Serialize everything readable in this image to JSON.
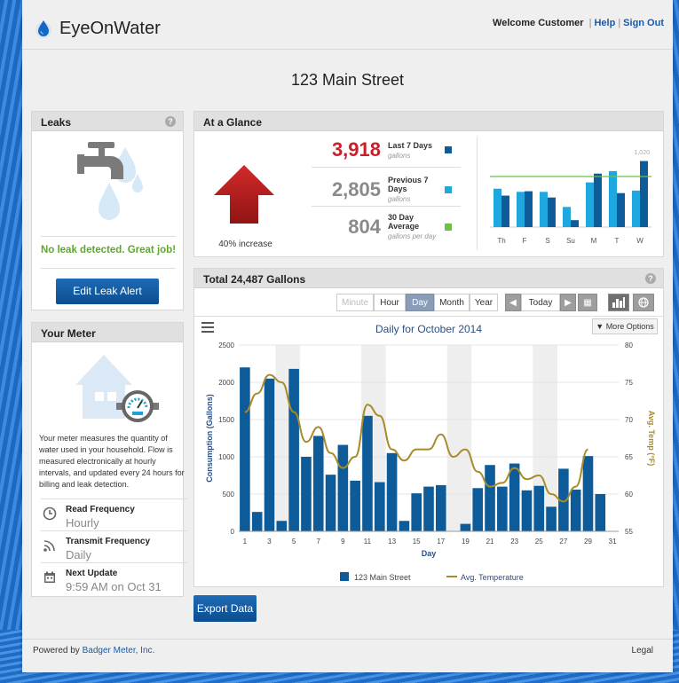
{
  "header": {
    "brand": "EyeOnWater",
    "welcome": "Welcome Customer",
    "help": "Help",
    "signout": "Sign Out",
    "separator": "|"
  },
  "address": "123 Main Street",
  "leaks": {
    "title": "Leaks",
    "help_icon": "question-icon",
    "status": "No leak detected. Great job!",
    "status_color": "#5fa82d",
    "button": "Edit Leak Alert"
  },
  "meter": {
    "title": "Your Meter",
    "description": "Your meter measures the quantity of water used in your household. Flow is measured electronically at hourly intervals, and updated every 24 hours for billing and leak detection.",
    "rows": [
      {
        "label": "Read Frequency",
        "value": "Hourly",
        "icon": "clock-icon"
      },
      {
        "label": "Transmit Frequency",
        "value": "Daily",
        "icon": "signal-icon"
      },
      {
        "label": "Next Update",
        "value": "9:59 AM on Oct 31",
        "icon": "calendar-icon"
      }
    ]
  },
  "glance": {
    "title": "At a Glance",
    "trend_label": "40% increase",
    "trend_direction": "up",
    "stats": [
      {
        "value": "3,918",
        "label": "Last 7 Days",
        "sub": "gallons",
        "color": "#c8202a",
        "swatch": "#0d5c99"
      },
      {
        "value": "2,805",
        "label": "Previous 7 Days",
        "sub": "gallons",
        "color": "#8a8a8a",
        "swatch": "#1fa8e0"
      },
      {
        "value": "804",
        "label": "30 Day Average",
        "sub": "gallons per day",
        "color": "#8a8a8a",
        "swatch": "#6cc04a"
      }
    ],
    "mini_chart": {
      "days": [
        "Th",
        "F",
        "S",
        "Su",
        "M",
        "T",
        "W"
      ],
      "last7": [
        500,
        570,
        470,
        110,
        850,
        540,
        1050
      ],
      "previous7": [
        610,
        560,
        560,
        320,
        710,
        890,
        580
      ],
      "average": 804,
      "max_label": "1,020",
      "ymax": 1100
    }
  },
  "total": {
    "title": "Total 24,487 Gallons",
    "toolbar": {
      "periods": [
        "Minute",
        "Hour",
        "Day",
        "Month",
        "Year"
      ],
      "selected": "Day",
      "disabled": "Minute",
      "today": "Today",
      "prev_icon": "arrow-left-icon",
      "next_icon": "arrow-right-icon",
      "calendar_icon": "calendar-grid-icon",
      "bar_icon": "bar-chart-icon",
      "globe_icon": "globe-icon"
    },
    "menu_icon": "hamburger-icon",
    "more_options": "▼ More Options"
  },
  "chart_data": {
    "type": "bar",
    "title": "Daily for October 2014",
    "xlabel": "Day",
    "ylabel": "Consumption (Gallons)",
    "y2label": "Avg. Temp (°F)",
    "ylim": [
      0,
      2500
    ],
    "y2lim": [
      55,
      80
    ],
    "yticks": [
      0,
      500,
      1000,
      1500,
      2000,
      2500
    ],
    "y2ticks": [
      55,
      60,
      65,
      70,
      75,
      80
    ],
    "xticks": [
      1,
      3,
      5,
      7,
      9,
      11,
      13,
      15,
      17,
      19,
      21,
      23,
      25,
      27,
      29,
      31
    ],
    "bar_color": "#0d5c99",
    "line_color": "#a88b2a",
    "series": [
      {
        "name": "123 Main Street",
        "type": "bar",
        "x": [
          1,
          2,
          3,
          4,
          5,
          6,
          7,
          8,
          9,
          10,
          11,
          12,
          13,
          14,
          15,
          16,
          17,
          18,
          19,
          20,
          21,
          22,
          23,
          24,
          25,
          26,
          27,
          28,
          29,
          30,
          31
        ],
        "values": [
          2200,
          260,
          2050,
          140,
          2180,
          1000,
          1280,
          760,
          1160,
          680,
          1550,
          660,
          1050,
          140,
          510,
          600,
          620,
          0,
          100,
          580,
          890,
          600,
          910,
          550,
          610,
          330,
          840,
          560,
          1010,
          500,
          0
        ]
      },
      {
        "name": "Avg. Temperature",
        "type": "line",
        "x": [
          1,
          2,
          3,
          4,
          5,
          6,
          7,
          8,
          9,
          10,
          11,
          12,
          13,
          14,
          15,
          16,
          17,
          18,
          19,
          20,
          21,
          22,
          23,
          24,
          25,
          26,
          27,
          28,
          29
        ],
        "values": [
          71,
          73.5,
          76,
          75,
          71,
          67,
          69,
          65.5,
          63.5,
          65,
          72,
          70.5,
          66,
          64.5,
          66,
          66,
          68,
          65,
          66,
          63,
          61,
          61.5,
          63.5,
          62,
          62.5,
          60,
          59,
          61,
          66
        ]
      }
    ],
    "shaded_days": [
      4,
      5,
      11,
      12,
      18,
      19,
      25,
      26
    ],
    "legend": "bottom-center"
  },
  "export_button": "Export Data",
  "footer": {
    "powered_prefix": "Powered by ",
    "powered_link": "Badger Meter, Inc.",
    "legal": "Legal"
  }
}
